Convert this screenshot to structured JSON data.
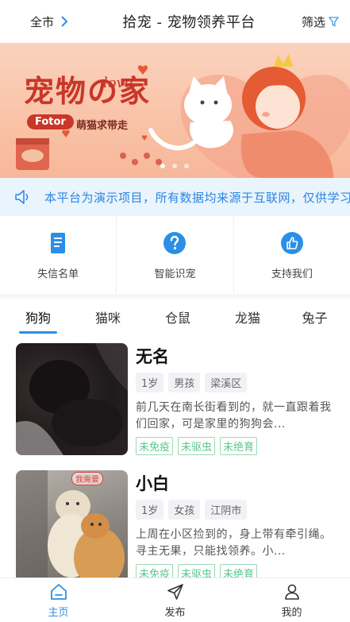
{
  "header": {
    "city": "全市",
    "title": "拾宠 - 宠物领养平台",
    "filter": "筛选"
  },
  "banner": {
    "headline": "宠物の家",
    "love": "love",
    "brand": "Fotor",
    "slogan": "萌猫求带走"
  },
  "notice": {
    "text": "本平台为演示项目，所有数据均来源于互联网，仅供学习交流使用"
  },
  "features": [
    {
      "label": "失信名单",
      "icon": "document-icon"
    },
    {
      "label": "智能识宠",
      "icon": "question-icon"
    },
    {
      "label": "支持我们",
      "icon": "thumbs-up-icon"
    }
  ],
  "tabs": [
    {
      "label": "狗狗",
      "active": true
    },
    {
      "label": "猫咪",
      "active": false
    },
    {
      "label": "仓鼠",
      "active": false
    },
    {
      "label": "龙猫",
      "active": false
    },
    {
      "label": "兔子",
      "active": false
    }
  ],
  "pets": [
    {
      "name": "无名",
      "age": "1岁",
      "gender": "男孩",
      "location": "梁溪区",
      "description": "前几天在南长街看到的，就一直跟着我们回家，可是家里的狗狗会...",
      "status": [
        "未免疫",
        "未驱虫",
        "未绝育"
      ]
    },
    {
      "name": "小白",
      "age": "1岁",
      "gender": "女孩",
      "location": "江阴市",
      "description": "上周在小区捡到的，身上带有牵引绳。寻主无果，只能找领养。小...",
      "status": [
        "未免疫",
        "未驱虫",
        "未绝育"
      ],
      "photo_stamp": "我需要"
    }
  ],
  "bottom_nav": [
    {
      "label": "主页",
      "icon": "home-icon",
      "active": true
    },
    {
      "label": "发布",
      "icon": "send-icon",
      "active": false
    },
    {
      "label": "我的",
      "icon": "user-icon",
      "active": false
    }
  ],
  "colors": {
    "accent": "#2b8fe6",
    "notice_bg": "#eaf4fd",
    "status_green": "#5cc58f"
  }
}
